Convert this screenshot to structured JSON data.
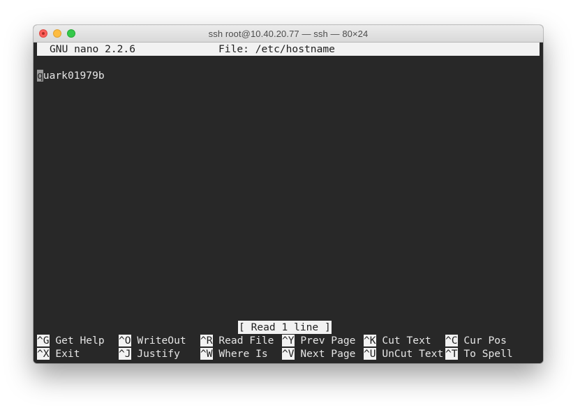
{
  "window": {
    "title": "ssh root@10.40.20.77 — ssh — 80×24"
  },
  "nano": {
    "version": "GNU nano 2.2.6",
    "file_label": "File: /etc/hostname",
    "content_cursor_char": "q",
    "content_rest": "uark01979b",
    "status": "[ Read 1 line ]",
    "shortcuts_row1": [
      {
        "key": "^G",
        "label": " Get Help"
      },
      {
        "key": "^O",
        "label": " WriteOut"
      },
      {
        "key": "^R",
        "label": " Read File"
      },
      {
        "key": "^Y",
        "label": " Prev Page"
      },
      {
        "key": "^K",
        "label": " Cut Text"
      },
      {
        "key": "^C",
        "label": " Cur Pos"
      }
    ],
    "shortcuts_row2": [
      {
        "key": "^X",
        "label": " Exit"
      },
      {
        "key": "^J",
        "label": " Justify"
      },
      {
        "key": "^W",
        "label": " Where Is"
      },
      {
        "key": "^V",
        "label": " Next Page"
      },
      {
        "key": "^U",
        "label": " UnCut Text"
      },
      {
        "key": "^T",
        "label": " To Spell"
      }
    ]
  },
  "colors": {
    "terminal_bg": "#282828",
    "header_bg": "#f2f2f2",
    "close_button": "#fc605c",
    "minimize_button": "#fdbc40",
    "zoom_button": "#34c84a"
  }
}
